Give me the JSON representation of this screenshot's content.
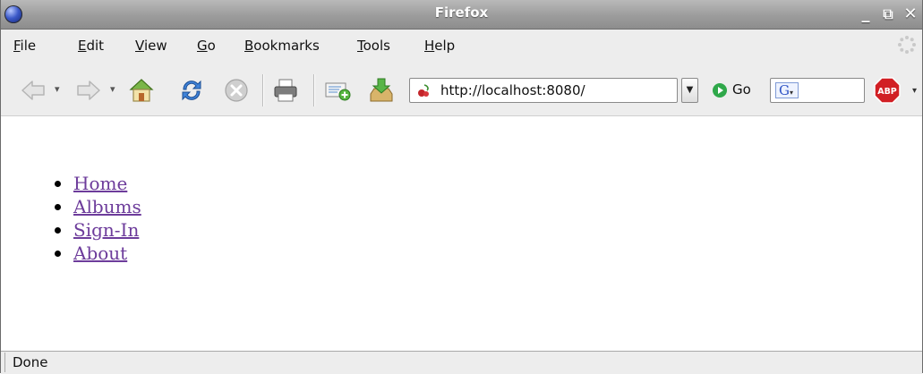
{
  "window": {
    "title": "Firefox",
    "minimize_glyph": "_",
    "maximize_glyph": "⧉",
    "close_glyph": "✕"
  },
  "menu": [
    {
      "label": "File",
      "accel": "F",
      "rest": "ile"
    },
    {
      "label": "Edit",
      "accel": "E",
      "rest": "dit"
    },
    {
      "label": "View",
      "accel": "V",
      "rest": "iew"
    },
    {
      "label": "Go",
      "accel": "G",
      "rest": "o"
    },
    {
      "label": "Bookmarks",
      "accel": "B",
      "rest": "ookmarks"
    },
    {
      "label": "Tools",
      "accel": "T",
      "rest": "ools"
    },
    {
      "label": "Help",
      "accel": "H",
      "rest": "elp"
    }
  ],
  "toolbar": {
    "icons": [
      "back-icon",
      "forward-icon",
      "home-icon",
      "reload-icon",
      "stop-icon",
      "print-icon",
      "new-bookmark-icon",
      "download-icon"
    ],
    "url": "http://localhost:8080/",
    "go_label": "Go",
    "search_engine": "G",
    "adblock_label": "ABP"
  },
  "page": {
    "links": [
      {
        "label": "Home"
      },
      {
        "label": "Albums"
      },
      {
        "label": "Sign-In"
      },
      {
        "label": "About"
      }
    ],
    "link_color": "#6d3c9b"
  },
  "status": {
    "text": "Done"
  }
}
